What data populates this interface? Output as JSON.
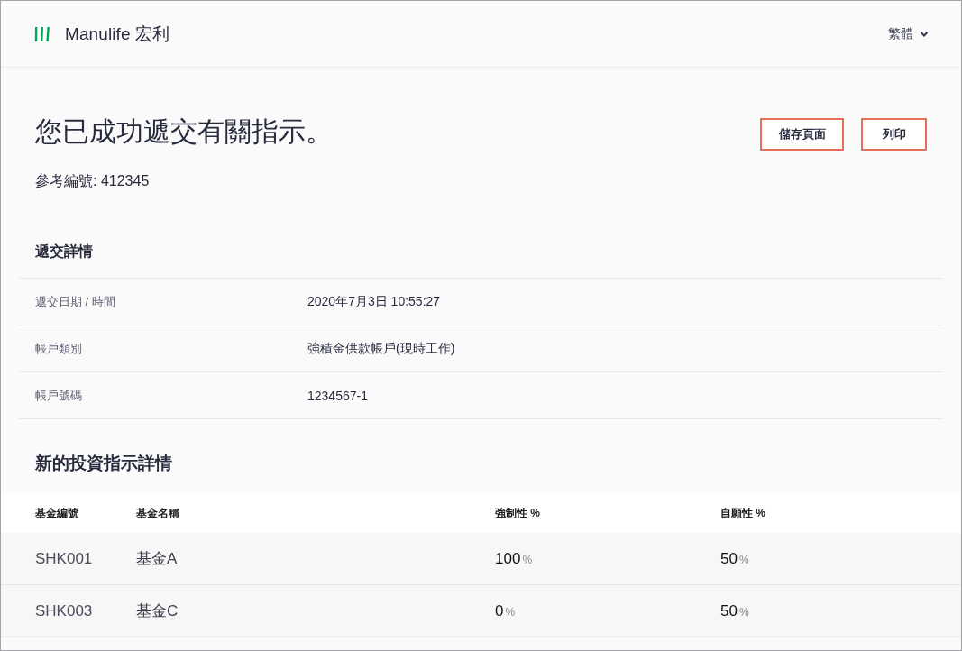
{
  "header": {
    "brand": "Manulife 宏利",
    "language": "繁體"
  },
  "confirmation": {
    "title": "您已成功遞交有關指示。",
    "reference": "參考編號: 412345",
    "buttons": [
      "儲存頁面",
      "列印"
    ]
  },
  "submission_details": {
    "heading": "遞交詳情",
    "rows": [
      {
        "label": "遞交日期 / 時間",
        "value": "2020年7月3日 10:55:27"
      },
      {
        "label": "帳戶類別",
        "value": "強積金供款帳戶(現時工作)"
      },
      {
        "label": "帳戶號碼",
        "value": "1234567-1"
      }
    ]
  },
  "investment_instructions": {
    "heading": "新的投資指示詳情",
    "columns": [
      "基金編號",
      "基金名稱",
      "強制性 %",
      "自願性 %"
    ],
    "rows": [
      {
        "code": "SHK001",
        "name": "基金A",
        "mandatory": {
          "value": "100",
          "unit": "%"
        },
        "voluntary": {
          "value": "50",
          "unit": "%"
        }
      },
      {
        "code": "SHK003",
        "name": "基金C",
        "mandatory": {
          "value": "0",
          "unit": "%"
        },
        "voluntary": {
          "value": "50",
          "unit": "%"
        }
      }
    ]
  }
}
